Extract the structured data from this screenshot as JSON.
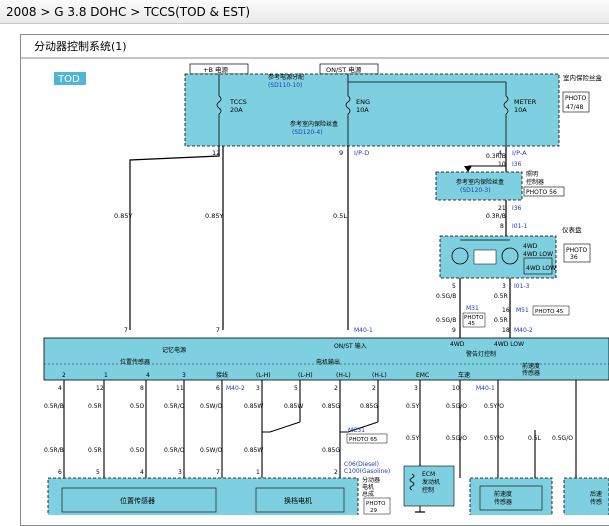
{
  "breadcrumb": {
    "model": "2008",
    "sep1": ">",
    "engine": "G 3.8 DOHC",
    "sep2": ">",
    "system": "TCCS(TOD & EST",
    "tail": ")"
  },
  "diagram": {
    "title": "分动器控制系统(1)",
    "tag": "TOD",
    "colors": {
      "module_fill": "#7ecfdf",
      "tag_fill": "#4fb6d8",
      "link_blue": "#1f3db3"
    },
    "power": {
      "b_plus_label": "+B 电源",
      "onst_label": "ON/ST 电源",
      "ref_power": "参考电源分配",
      "ref_power_code": "(SD110-10)",
      "ref_ground": "参考室内保险丝盒",
      "ref_ground_code": "(SD120-4)",
      "fuse_room": "室内保险丝盒",
      "photo": "PHOTO",
      "photo_no": "47/48",
      "fuses": [
        {
          "name": "TCCS",
          "amp": "20A"
        },
        {
          "name": "ENG",
          "amp": "10A"
        },
        {
          "name": "METER",
          "amp": "10A"
        }
      ]
    },
    "connectors": {
      "c1_12": "12",
      "c1_9": "9",
      "ipd": "I/P-D",
      "c1_4": "4",
      "ipa": "I/P-A",
      "wire_03rb": "0.3R/B",
      "c_10": "10",
      "i36a": "I36",
      "c_21": "21",
      "i36b": "I36",
      "c_8": "8",
      "i01_1": "I01-1",
      "c_5": "5",
      "c_3": "3",
      "i01_3": "I01-3",
      "c_7": "7",
      "c_9b": "9",
      "c_7b": "7",
      "c_16": "16",
      "c_18": "18",
      "m40_1": "M40-1",
      "m40_2": "M40-2",
      "m31": "M31",
      "m51": "M51",
      "photo": "PHOTO",
      "photo_45": "45",
      "photo_45b": "PHOTO 45"
    },
    "wires": {
      "w085y_a": "0.85Y",
      "w085y_b": "0.85Y",
      "w05l": "0.5L",
      "w05r": "0.5R",
      "w05gb": "0.5G/B",
      "w05r_b": "0.5R",
      "w05gb_b": "0.5G/B",
      "w05r_c": "0.5R"
    },
    "meter": {
      "ref": "参考室内保险丝盒",
      "ref_code": "(SD120-3)",
      "side1": "照明",
      "side2": "控制器",
      "photo": "PHOTO 56",
      "cluster": "仪表盘",
      "lamp_4wd": "4WD",
      "lamp_4wd_low": "4WD LOW",
      "box_4wd_low": "4WD LOW",
      "cluster_photo": "PHOTO",
      "cluster_photo_no": "36"
    },
    "tcu": {
      "sub_power": "记忆电源",
      "onst_in": "ON/ST 输入",
      "lbl_4wd": "4WD",
      "lbl_4wdlow": "4WD LOW",
      "lbl_indicator": "警告灯控制",
      "pos_sensor": "位置传感器",
      "lock": "接线",
      "motor_out": "电机输出",
      "emc": "EMC",
      "speed": "车速",
      "front_speed": "前速度",
      "front_speed2": "传感器",
      "rear_speed": "接线",
      "pins_top": [
        "2",
        "1",
        "4",
        "3"
      ],
      "motor_pins": [
        "(L-H)",
        "(L-H)",
        "(H-L)",
        "(H-L)"
      ]
    },
    "lower": {
      "pin_row1": [
        "4",
        "12",
        "8",
        "11",
        "6",
        "3",
        "5",
        "2",
        "2",
        "3",
        "10",
        "1"
      ],
      "wires_row1": [
        "0.5R/B",
        "0.5R",
        "0.5O",
        "0.5R/O",
        "0.5W/O",
        "0.85W",
        "0.85W",
        "0.85G",
        "0.85G",
        "0.5Y",
        "0.5G/O",
        "0.5Y/O"
      ],
      "m40_2": "M40-2",
      "m40_1": "M40-1",
      "mc31": "MC31",
      "photo65": "PHOTO 65",
      "c06": "C06(Diesel)",
      "c100": "C100(Gasoline)",
      "sub_box": "分动器",
      "sub_box2": "电机",
      "sub_box3": "总成",
      "photo29": "PHOTO",
      "photo29_no": "29",
      "wires_row2": [
        "0.5R/B",
        "0.5R",
        "0.5O",
        "0.5R/O",
        "0.5W/O",
        "0.85W",
        "0.85G",
        "0.5Y",
        "0.5G/O",
        "0.5Y/O",
        "0.5L",
        "0.5G/O"
      ],
      "pins_row2": [
        "6",
        "5",
        "4",
        "3",
        "7",
        "1",
        "2",
        "4",
        "5",
        "16",
        "18",
        "5"
      ],
      "pos_sensor_box": "位置传感器",
      "motor_box": "换档电机",
      "ecm": "ECM",
      "ecm2": "发动机",
      "ecm3": "控制",
      "front_speed_box": "前速度",
      "front_speed_box2": "传感器",
      "rear_box": "后速",
      "rear_box2": "传感"
    }
  }
}
